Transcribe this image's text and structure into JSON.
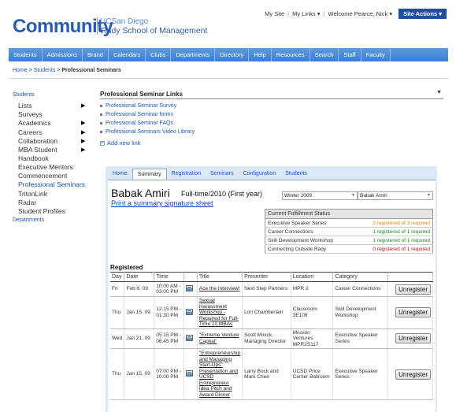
{
  "header": {
    "logo_text": "Community",
    "ucsd_text": "UCSan Diego",
    "school_text": "Rady School of Management",
    "my_site": "My Site",
    "my_links": "My Links ▾",
    "welcome": "Welcome Pearce, Nick ▾",
    "site_actions": "Site Actions ▾"
  },
  "nav": [
    "Students",
    "Admissions",
    "Brand",
    "Calendars",
    "Clubs",
    "Departments",
    "Directory",
    "Help",
    "Resources",
    "Search",
    "Staff",
    "Faculty"
  ],
  "breadcrumb": {
    "home": "Home",
    "sep": ">",
    "students": "Students",
    "current": "Professional Seminars"
  },
  "leftnav": {
    "heading": "Students",
    "items": [
      {
        "label": "Lists",
        "arrow": true
      },
      {
        "label": "Surveys",
        "arrow": false
      },
      {
        "label": "Academics",
        "arrow": true
      },
      {
        "label": "Careers",
        "arrow": true
      },
      {
        "label": "Collaboration",
        "arrow": true
      },
      {
        "label": "MBA Student Handbook",
        "arrow": true
      },
      {
        "label": "Executive Mentors",
        "arrow": false
      },
      {
        "label": "Commencement",
        "arrow": false
      },
      {
        "label": "Professional Seminars",
        "arrow": false,
        "active": true
      },
      {
        "label": "TritonLink",
        "arrow": false
      },
      {
        "label": "Radar",
        "arrow": false
      },
      {
        "label": "Student Profiles",
        "arrow": false
      }
    ],
    "footer": "Departments"
  },
  "psl": {
    "title": "Professional Seminar Links",
    "links": [
      "Professional Seminar Survey",
      "Professional Seminar forms",
      "Professional Seminar FAQs",
      "Professional Seminars Video Library"
    ],
    "add_new": "Add new link"
  },
  "tabs": [
    {
      "label": "Home",
      "active": false
    },
    {
      "label": "Summary",
      "active": true
    },
    {
      "label": "Registration",
      "active": false
    },
    {
      "label": "Seminars",
      "active": false
    },
    {
      "label": "Configuration",
      "active": false
    },
    {
      "label": "Students",
      "active": false
    }
  ],
  "student": {
    "name": "Babak Amiri",
    "meta": "Full-time/2010 (First year)",
    "print_link": "Print a summary signature sheet",
    "term_select": "Winter 2009",
    "student_select": "Babak Amiri"
  },
  "fulfillment": {
    "header": "Current Fulfillment Status",
    "rows": [
      {
        "name": "Executive Speaker Series",
        "status": "2 registered of 3 required",
        "color": "#e08a00"
      },
      {
        "name": "Career Connections",
        "status": "1 registered of 1 required",
        "color": "#1f8a1f"
      },
      {
        "name": "Skill Development Workshop",
        "status": "1 registered of 1 required",
        "color": "#1f8a1f"
      },
      {
        "name": "Connecting Outside Rady",
        "status": "0 registered of 1 required",
        "color": "#cc1111"
      }
    ]
  },
  "registered": {
    "title": "Registered",
    "columns": [
      "Day",
      "Date",
      "Time",
      "",
      "Title",
      "Presenter",
      "Location",
      "Category",
      ""
    ],
    "unregister_label": "Unregister",
    "rows": [
      {
        "day": "Fri",
        "date": "Feb 6, 09",
        "time": "10:00 AM - 03:00 PM",
        "title": "Ace the Interview!",
        "presenter": "Next Step Partners",
        "location": "MPR 2",
        "category": "Career Connections"
      },
      {
        "day": "Thu",
        "date": "Jan 15, 09",
        "time": "12:15 PM - 01:30 PM",
        "title": "Sexual Harassment Workshop - Required for Full-Time 10 MBAs",
        "presenter": "Lori Chamberlain",
        "location": "Classroom 3E109",
        "category": "Skill Development Workshop"
      },
      {
        "day": "Wed",
        "date": "Jan 21, 09",
        "time": "05:15 PM - 06:45 PM",
        "title": "\"Extreme Venture Capital\"",
        "presenter": "Scott Minick, Managing Director",
        "location": "Mission Ventures MPR2S117",
        "category": "Executive Speaker Series"
      },
      {
        "day": "Thu",
        "date": "Jan 15, 09",
        "time": "07:00 PM - 10:00 PM",
        "title": "\"Entrepreneurship and Managing Start-Ups\" Presentation and UCSD Entrepreneur Idea Pitch and Award Dinner",
        "presenter": "Larry Bock and Mark Chee",
        "location": "UCSD Price Center Ballroom",
        "category": "Executive Speaker Series"
      }
    ]
  }
}
